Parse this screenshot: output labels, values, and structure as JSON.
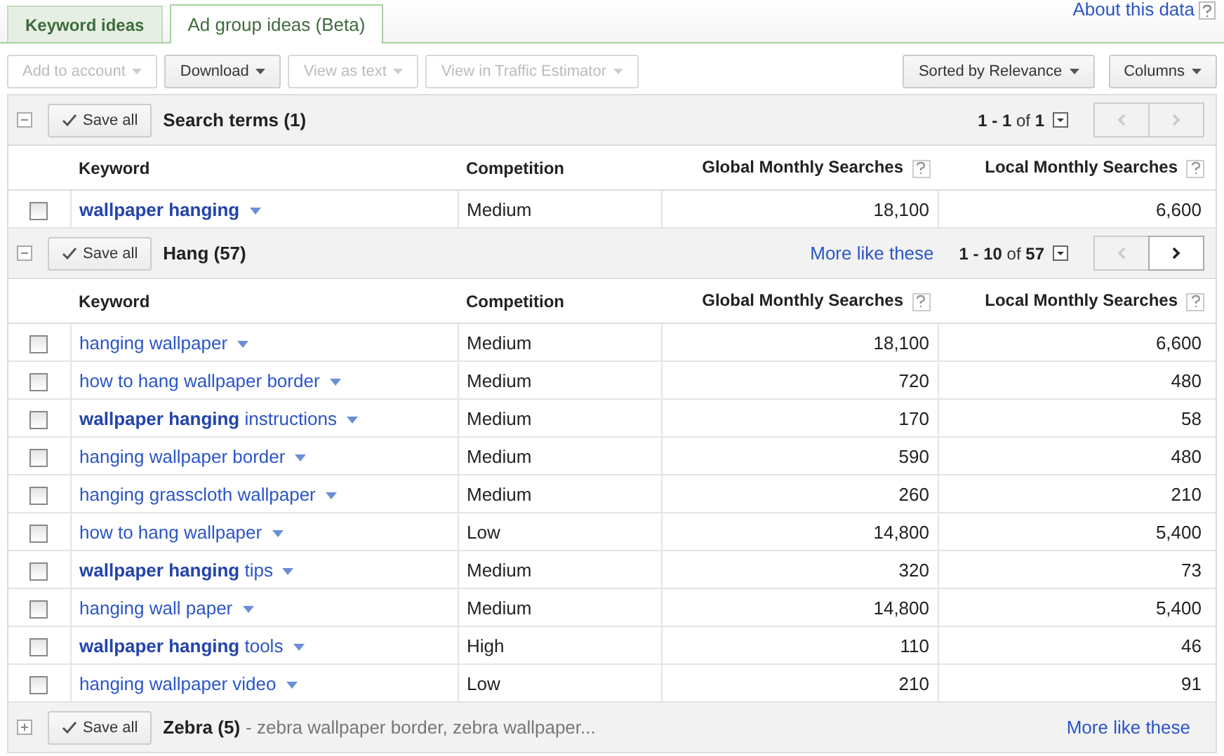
{
  "tabs": [
    {
      "label": "Keyword ideas",
      "selected": false
    },
    {
      "label": "Ad group ideas (Beta)",
      "selected": true
    }
  ],
  "about_link": "About this data",
  "toolbar": {
    "left_buttons": [
      {
        "label": "Add to account",
        "disabled": true
      },
      {
        "label": "Download",
        "disabled": false
      },
      {
        "label": "View as text",
        "disabled": true
      },
      {
        "label": "View in Traffic Estimator",
        "disabled": true
      }
    ],
    "right_buttons": [
      {
        "label": "Sorted by Relevance",
        "disabled": false
      },
      {
        "label": "Columns",
        "disabled": false
      }
    ]
  },
  "groups": [
    {
      "expanded": true,
      "save_label": "Save all",
      "title": "Search terms (1)",
      "pager": "**1 - 1** of **1**",
      "prev_disabled": true,
      "next_disabled": true,
      "columns": [
        "Keyword",
        "Competition",
        "Global Monthly Searches",
        "Local Monthly Searches"
      ],
      "rows": [
        {
          "checked": false,
          "keyword": "**wallpaper hanging**",
          "competition": "Medium",
          "global": "18,100",
          "local": "6,600"
        }
      ]
    },
    {
      "expanded": true,
      "save_label": "Save all",
      "title": "Hang (57)",
      "more_link": "More like these",
      "pager": "**1 - 10** of **57**",
      "prev_disabled": true,
      "next_disabled": false,
      "columns": [
        "Keyword",
        "Competition",
        "Global Monthly Searches",
        "Local Monthly Searches"
      ],
      "rows": [
        {
          "checked": false,
          "keyword": "hanging wallpaper",
          "competition": "Medium",
          "global": "18,100",
          "local": "6,600"
        },
        {
          "checked": false,
          "keyword": "how to hang wallpaper border",
          "competition": "Medium",
          "global": "720",
          "local": "480"
        },
        {
          "checked": false,
          "keyword": "**wallpaper hanging** instructions",
          "competition": "Medium",
          "global": "170",
          "local": "58"
        },
        {
          "checked": false,
          "keyword": "hanging wallpaper border",
          "competition": "Medium",
          "global": "590",
          "local": "480"
        },
        {
          "checked": false,
          "keyword": "hanging grasscloth wallpaper",
          "competition": "Medium",
          "global": "260",
          "local": "210"
        },
        {
          "checked": false,
          "keyword": "how to hang wallpaper",
          "competition": "Low",
          "global": "14,800",
          "local": "5,400"
        },
        {
          "checked": false,
          "keyword": "**wallpaper hanging** tips",
          "competition": "Medium",
          "global": "320",
          "local": "73"
        },
        {
          "checked": false,
          "keyword": "hanging wall paper",
          "competition": "Medium",
          "global": "14,800",
          "local": "5,400"
        },
        {
          "checked": false,
          "keyword": "**wallpaper hanging** tools",
          "competition": "High",
          "global": "110",
          "local": "46"
        },
        {
          "checked": false,
          "keyword": "hanging wallpaper video",
          "competition": "Low",
          "global": "210",
          "local": "91"
        }
      ]
    },
    {
      "expanded": false,
      "save_label": "Save all",
      "title": "Zebra (5)",
      "summary": "- zebra wallpaper border, zebra wallpaper...",
      "more_link": "More like these"
    }
  ]
}
